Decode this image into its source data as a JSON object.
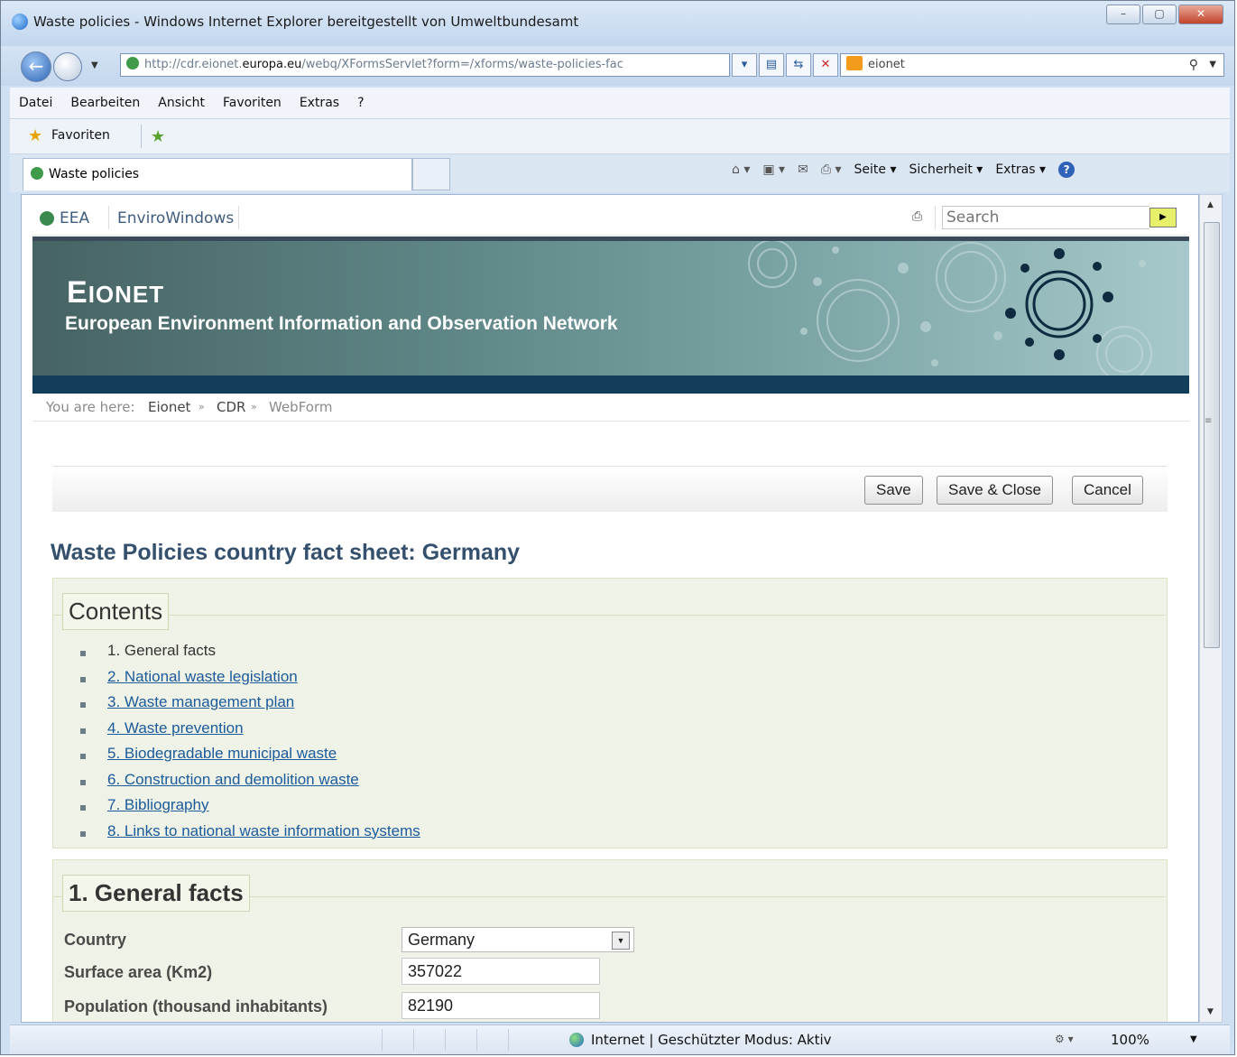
{
  "window": {
    "title": "Waste policies - Windows Internet Explorer bereitgestellt von Umweltbundesamt",
    "min": "–",
    "max": "▢",
    "close": "✕"
  },
  "address": {
    "url_prefix": "http://cdr.eionet.",
    "url_host": "europa.eu",
    "url_rest": "/webq/XFormsServlet?form=/xforms/waste-policies-fac",
    "search_value": "eionet"
  },
  "menu": [
    "Datei",
    "Bearbeiten",
    "Ansicht",
    "Favoriten",
    "Extras",
    "?"
  ],
  "favorites": {
    "label": "Favoriten"
  },
  "tab": {
    "label": "Waste policies"
  },
  "commandbar": {
    "page": "Seite ▾",
    "security": "Sicherheit ▾",
    "extras": "Extras ▾"
  },
  "eea": {
    "eea_label": "EEA",
    "envirowindows": "EnviroWindows",
    "search_placeholder": "Search"
  },
  "banner": {
    "title_big": "E",
    "title_small": "IONET",
    "subtitle": "European Environment Information and Observation Network"
  },
  "breadcrumb": {
    "prefix": "You are here:",
    "eionet": "Eionet",
    "cdr": "CDR",
    "webform": "WebForm",
    "sep": "»"
  },
  "buttons": {
    "save": "Save",
    "save_close": "Save & Close",
    "cancel": "Cancel"
  },
  "page_title": "Waste Policies country fact sheet: Germany",
  "contents": {
    "legend": "Contents",
    "items": [
      {
        "label": "1. General facts"
      },
      {
        "label": "2. National waste legislation"
      },
      {
        "label": "3. Waste management plan"
      },
      {
        "label": "4. Waste prevention"
      },
      {
        "label": "5. Biodegradable municipal waste"
      },
      {
        "label": "6. Construction and demolition waste"
      },
      {
        "label": "7. Bibliography"
      },
      {
        "label": "8. Links to national waste information systems"
      }
    ]
  },
  "general_facts": {
    "legend": "1. General facts",
    "country_label": "Country",
    "country_value": "Germany",
    "surface_label": "Surface area (Km2)",
    "surface_value": "357022",
    "population_label": "Population (thousand inhabitants)",
    "population_value": "82190"
  },
  "status": {
    "text": "Internet | Geschützter Modus: Aktiv",
    "zoom": "100%"
  }
}
